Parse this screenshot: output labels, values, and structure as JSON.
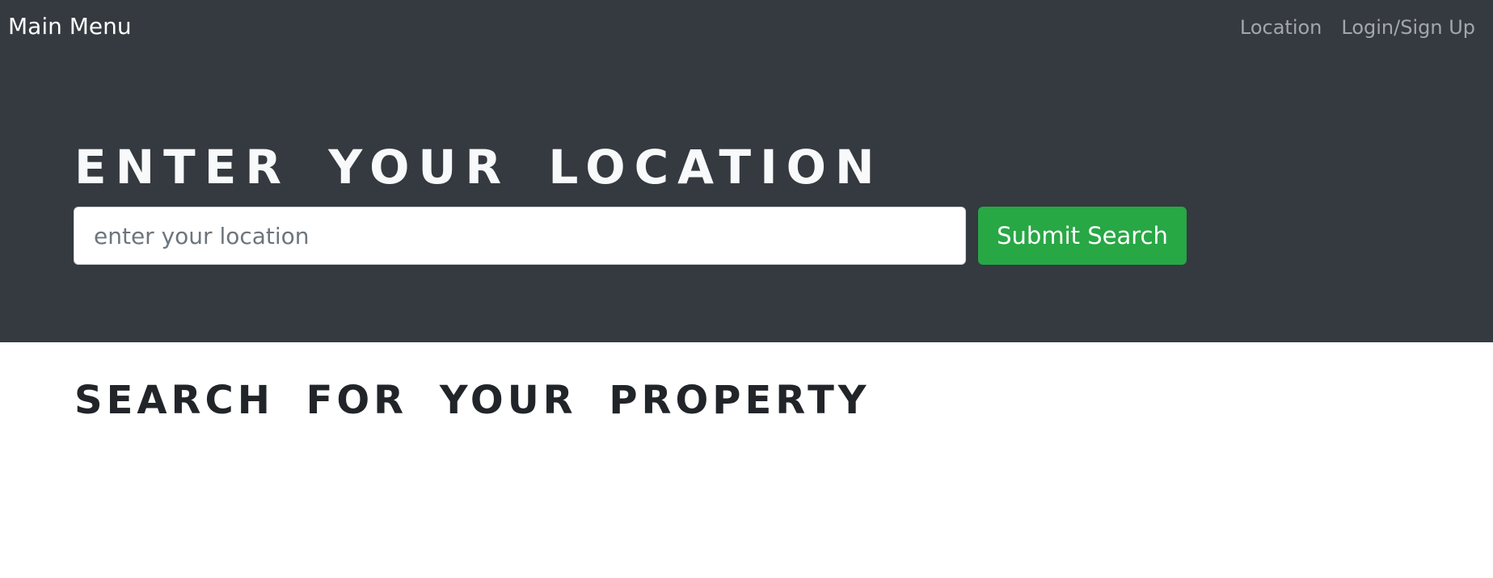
{
  "navbar": {
    "brand": "Main Menu",
    "links": [
      {
        "label": "Location"
      },
      {
        "label": "Login/Sign Up"
      }
    ]
  },
  "hero": {
    "title": "ENTER YOUR LOCATION",
    "search": {
      "placeholder": "enter your location",
      "value": "",
      "button_label": "Submit Search",
      "button_color": "#28a745"
    },
    "background_color": "#343a40"
  },
  "section": {
    "title": "SEARCH FOR YOUR PROPERTY"
  }
}
